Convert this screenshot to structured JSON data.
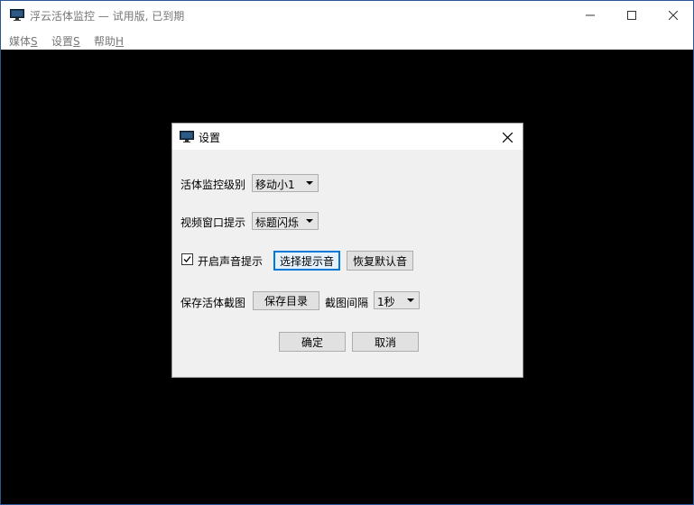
{
  "window": {
    "title": "浮云活体监控 — 试用版, 已到期"
  },
  "menu": {
    "items": [
      {
        "label": "媒体",
        "accel": "S"
      },
      {
        "label": "设置",
        "accel": "S"
      },
      {
        "label": "帮助",
        "accel": "H"
      }
    ]
  },
  "dialog": {
    "title": "设置",
    "monitor_level": {
      "label": "活体监控级别",
      "value": "移动小1"
    },
    "video_prompt": {
      "label": "视频窗口提示",
      "value": "标题闪烁"
    },
    "sound": {
      "label": "开启声音提示",
      "checked": true,
      "choose_label": "选择提示音",
      "restore_label": "恢复默认音"
    },
    "save": {
      "label": "保存活体截图",
      "dir_label": "保存目录",
      "interval_label": "截图间隔",
      "interval_value": "1秒"
    },
    "ok_label": "确定",
    "cancel_label": "取消"
  },
  "colors": {
    "content_bg": "#000000",
    "dialog_bg": "#f0f0f0",
    "focus_border": "#0078d7",
    "window_border": "#2b5797"
  }
}
